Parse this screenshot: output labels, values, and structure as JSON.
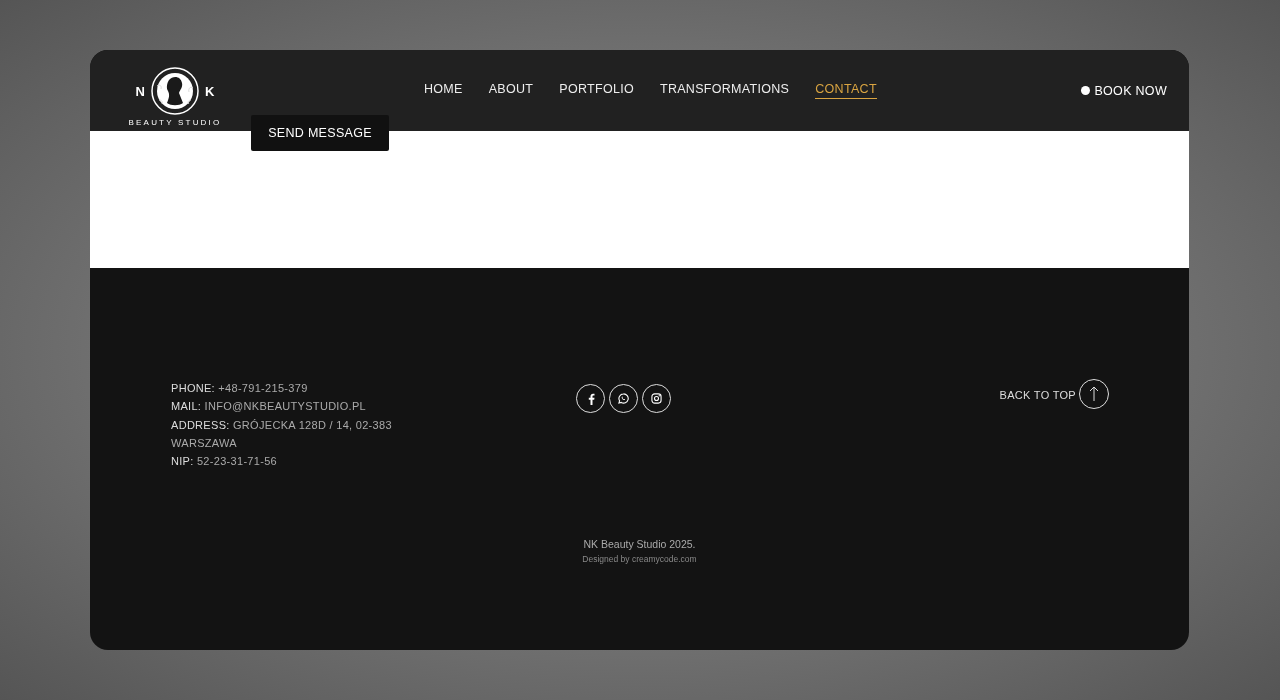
{
  "logo": {
    "left_letter": "N",
    "right_letter": "K",
    "tagline": "BEAUTY STUDIO"
  },
  "nav": [
    {
      "label": "HOME",
      "selected": false
    },
    {
      "label": "ABOUT",
      "selected": false
    },
    {
      "label": "PORTFOLIO",
      "selected": false
    },
    {
      "label": "TRANSFORMATIONS",
      "selected": false
    },
    {
      "label": "CONTACT",
      "selected": true
    }
  ],
  "book_button": "BOOK NOW",
  "send_button": "SEND MESSAGE",
  "contact": [
    {
      "label": "PHONE:",
      "value": "+48-791-215-379"
    },
    {
      "label": "MAIL:",
      "value": "INFO@NKBEAUTYSTUDIO.PL"
    },
    {
      "label": "ADDRESS:",
      "value": "GRÓJECKA 128D / 14, 02-383"
    },
    {
      "value": "WARSZAWA"
    },
    {
      "label": "NIP:",
      "value": "52-23-31-71-56"
    }
  ],
  "social": [
    {
      "kind": "facebook"
    },
    {
      "kind": "whatsapp"
    },
    {
      "kind": "instagram"
    }
  ],
  "back_to_top": "BACK TO TOP",
  "copyright": "NK Beauty Studio 2025.",
  "credit": "Designed by creamycode.com"
}
